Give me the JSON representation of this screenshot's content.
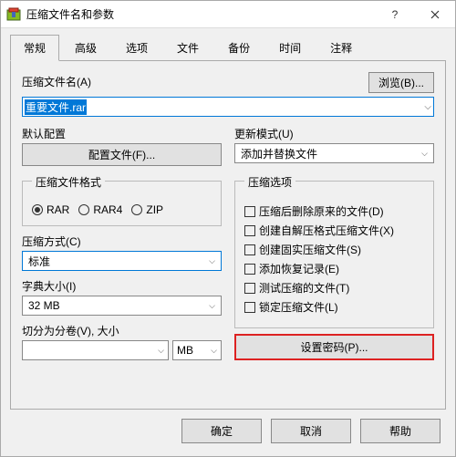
{
  "title": "压缩文件名和参数",
  "tabs": [
    "常规",
    "高级",
    "选项",
    "文件",
    "备份",
    "时间",
    "注释"
  ],
  "archiveName": {
    "label": "压缩文件名(A)",
    "browse": "浏览(B)...",
    "value": "重要文件.rar"
  },
  "profile": {
    "label": "默认配置",
    "button": "配置文件(F)..."
  },
  "updateMode": {
    "label": "更新模式(U)",
    "value": "添加并替换文件"
  },
  "format": {
    "legend": "压缩文件格式",
    "options": [
      "RAR",
      "RAR4",
      "ZIP"
    ],
    "selected": "RAR"
  },
  "method": {
    "label": "压缩方式(C)",
    "value": "标准"
  },
  "dict": {
    "label": "字典大小(I)",
    "value": "32 MB"
  },
  "split": {
    "label": "切分为分卷(V), 大小",
    "value": "",
    "unit": "MB"
  },
  "options": {
    "legend": "压缩选项",
    "items": [
      "压缩后删除原来的文件(D)",
      "创建自解压格式压缩文件(X)",
      "创建固实压缩文件(S)",
      "添加恢复记录(E)",
      "测试压缩的文件(T)",
      "锁定压缩文件(L)"
    ]
  },
  "password": {
    "button": "设置密码(P)..."
  },
  "footer": {
    "ok": "确定",
    "cancel": "取消",
    "help": "帮助"
  }
}
